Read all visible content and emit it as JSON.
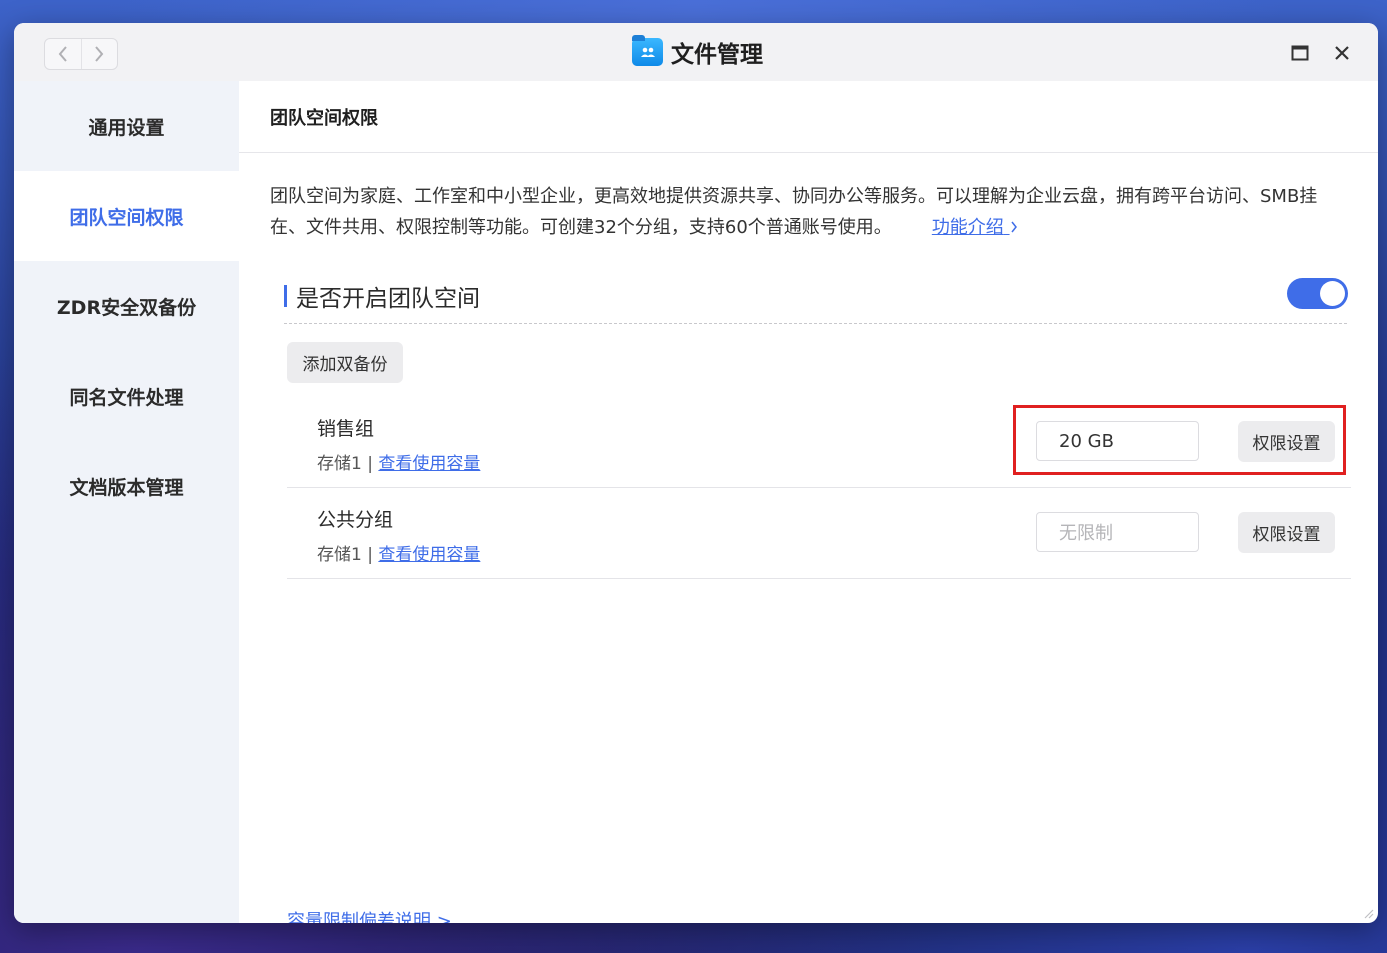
{
  "window": {
    "title": "文件管理"
  },
  "sidebar": {
    "items": [
      {
        "label": "通用设置"
      },
      {
        "label": "团队空间权限"
      },
      {
        "label": "ZDR安全双备份"
      },
      {
        "label": "同名文件处理"
      },
      {
        "label": "文档版本管理"
      }
    ],
    "active_index": 1
  },
  "main": {
    "header": "团队空间权限",
    "description": "团队空间为家庭、工作室和中小型企业，更高效地提供资源共享、协同办公等服务。可以理解为企业云盘，拥有跨平台访问、SMB挂在、文件共用、权限控制等功能。可创建32个分组，支持60个普通账号使用。",
    "intro_link": "功能介绍",
    "section_title": "是否开启团队空间",
    "toggle_on": true,
    "add_backup_label": "添加双备份",
    "groups": [
      {
        "name": "销售组",
        "storage": "存储1",
        "separator": "|",
        "usage_link": "查看使用容量",
        "quota_value": "20 GB",
        "quota_placeholder": "",
        "perm_label": "权限设置"
      },
      {
        "name": "公共分组",
        "storage": "存储1",
        "separator": "|",
        "usage_link": "查看使用容量",
        "quota_value": "",
        "quota_placeholder": "无限制",
        "perm_label": "权限设置"
      }
    ],
    "footer_link": "容量限制偏差说明 >"
  },
  "colors": {
    "accent": "#3f6de8",
    "highlight": "#e02020",
    "sidebar_bg": "#f0f3f9"
  }
}
